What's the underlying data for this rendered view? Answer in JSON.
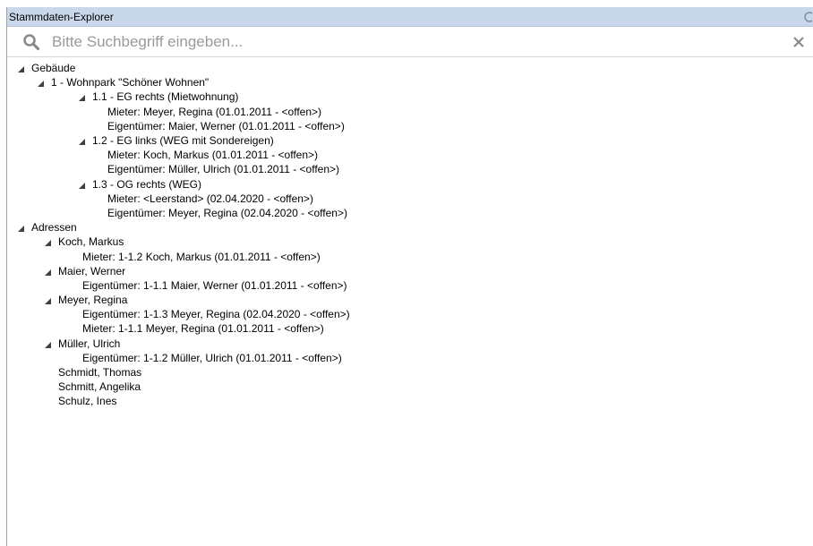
{
  "window": {
    "title": "Stammdaten-Explorer"
  },
  "search": {
    "placeholder": "Bitte Suchbegriff eingeben...",
    "value": ""
  },
  "tree": {
    "gebaeude": {
      "label": "Gebäude",
      "wohnpark": {
        "label": "1 - Wohnpark \"Schöner Wohnen\"",
        "units": [
          {
            "label": "1.1 - EG rechts (Mietwohnung)",
            "children": [
              "Mieter: Meyer, Regina (01.01.2011 - <offen>)",
              "Eigentümer: Maier, Werner (01.01.2011 - <offen>)"
            ]
          },
          {
            "label": "1.2 - EG links (WEG mit Sondereigen)",
            "children": [
              "Mieter: Koch, Markus (01.01.2011 - <offen>)",
              "Eigentümer: Müller, Ulrich (01.01.2011 - <offen>)"
            ]
          },
          {
            "label": "1.3 - OG rechts (WEG)",
            "children": [
              "Mieter: <Leerstand> (02.04.2020 - <offen>)",
              "Eigentümer: Meyer, Regina (02.04.2020 - <offen>)"
            ]
          }
        ]
      }
    },
    "adressen": {
      "label": "Adressen",
      "persons": [
        {
          "label": "Koch, Markus",
          "children": [
            "Mieter: 1-1.2 Koch, Markus (01.01.2011 - <offen>)"
          ]
        },
        {
          "label": "Maier, Werner",
          "children": [
            "Eigentümer: 1-1.1 Maier, Werner (01.01.2011 - <offen>)"
          ]
        },
        {
          "label": "Meyer, Regina",
          "children": [
            "Eigentümer: 1-1.3 Meyer, Regina (02.04.2020 - <offen>)",
            "Mieter: 1-1.1 Meyer, Regina (01.01.2011 - <offen>)"
          ]
        },
        {
          "label": "Müller, Ulrich",
          "children": [
            "Eigentümer: 1-1.2 Müller, Ulrich (01.01.2011 - <offen>)"
          ]
        }
      ],
      "leaf_persons": [
        "Schmidt, Thomas",
        "Schmitt, Angelika",
        "Schulz, Ines"
      ]
    }
  },
  "icons": {
    "search": "search-icon",
    "clear": "close-icon",
    "expanded": "expanded-triangle-icon",
    "pin": "pin-icon"
  },
  "colors": {
    "titlebar": "#c9d7ea",
    "icon_gray": "#8a8a8a",
    "placeholder": "#9a9a9a"
  }
}
